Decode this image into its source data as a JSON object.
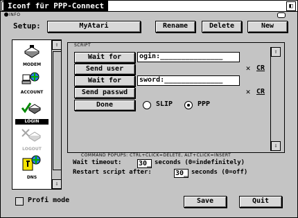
{
  "window": {
    "title": "Iconf für PPP-Connect"
  },
  "info_label": "INFO",
  "setup": {
    "label": "Setup:",
    "value": "MyAtari",
    "rename": "Rename",
    "delete": "Delete",
    "new": "New"
  },
  "sidebar": {
    "items": [
      {
        "label": "MODEM"
      },
      {
        "label": "ACCOUNT"
      },
      {
        "label": "LOGIN"
      },
      {
        "label": "LOGOUT"
      },
      {
        "label": "DNS"
      }
    ]
  },
  "script": {
    "section_label": "SCRIPT",
    "rows": [
      {
        "button": "Wait for",
        "text": "ogin:_______________"
      },
      {
        "button": "Send user",
        "cr_label": "CR"
      },
      {
        "button": "Wait for",
        "text": "sword:______________"
      },
      {
        "button": "Send passwd",
        "cr_label": "CR"
      },
      {
        "button": "Done"
      }
    ],
    "slip_label": "SLIP",
    "ppp_label": "PPP"
  },
  "popups_hint": "COMMAND POPUPS: CTRL+CLICK=DELETE, ALT+CLICK=INSERT",
  "timeout": {
    "wait_label": "Wait timeout:",
    "wait_value": "30_",
    "wait_suffix": "seconds (0=indefinitely)",
    "restart_label": "Restart script after:",
    "restart_value": "30_",
    "restart_suffix": "seconds (0=off)"
  },
  "footer": {
    "profi_label": "Profi mode",
    "save": "Save",
    "quit": "Quit"
  }
}
